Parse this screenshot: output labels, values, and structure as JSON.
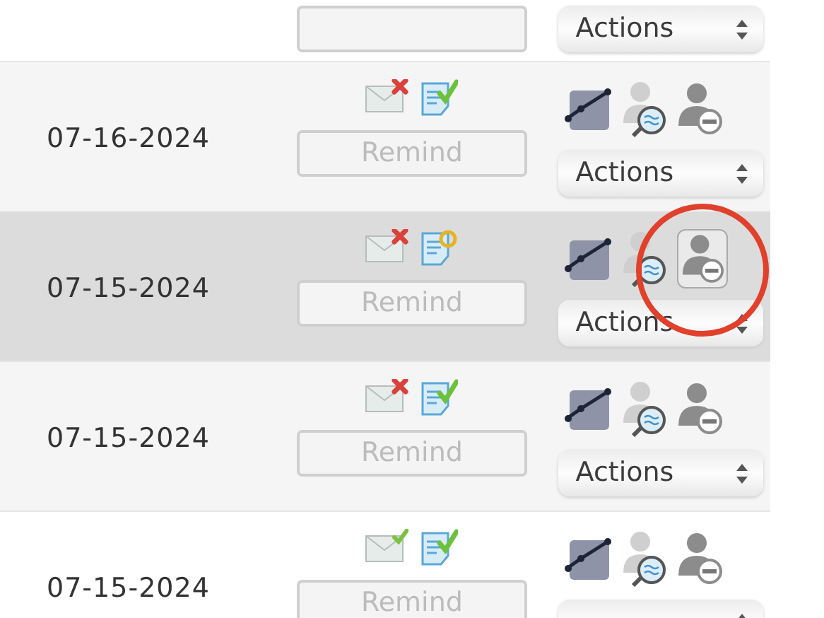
{
  "rows": [
    {
      "date": null,
      "remind": null,
      "actions": "Actions",
      "selected": false,
      "annotated": false
    },
    {
      "date": "07-16-2024",
      "mail_failed": true,
      "doc_signed": true,
      "remind": "Remind",
      "actions": "Actions",
      "selected": false,
      "annotated": false
    },
    {
      "date": "07-15-2024",
      "mail_failed": true,
      "doc_signed": false,
      "remind": "Remind",
      "actions": "Actions",
      "selected": true,
      "annotated": true
    },
    {
      "date": "07-15-2024",
      "mail_failed": true,
      "doc_signed": true,
      "remind": "Remind",
      "actions": "Actions",
      "selected": false,
      "annotated": false
    },
    {
      "date": "07-15-2024",
      "mail_failed": false,
      "doc_signed": true,
      "remind": "Remind",
      "actions": null,
      "selected": false,
      "annotated": false
    }
  ]
}
